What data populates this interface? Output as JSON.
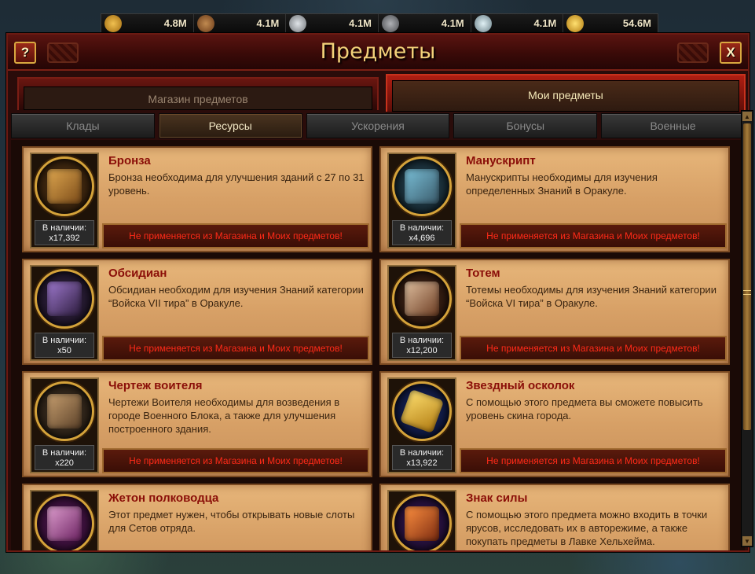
{
  "resources": [
    {
      "icon": "wheat-icon",
      "value": "4.8M",
      "color": "#d9a030"
    },
    {
      "icon": "wood-icon",
      "value": "4.1M",
      "color": "#a06a3a"
    },
    {
      "icon": "iron-icon",
      "value": "4.1M",
      "color": "#c0c4c8"
    },
    {
      "icon": "stone-icon",
      "value": "4.1M",
      "color": "#8a8c90"
    },
    {
      "icon": "silver-icon",
      "value": "4.1M",
      "color": "#b4c8d0"
    },
    {
      "icon": "gold-icon",
      "value": "54.6M",
      "color": "#f0c030"
    }
  ],
  "window": {
    "title": "Предметы",
    "help_label": "?",
    "close_label": "X"
  },
  "tabs": {
    "shop": "Магазин предметов",
    "mine": "Мои предметы",
    "active": "mine"
  },
  "subtabs": [
    {
      "label": "Клады",
      "active": false
    },
    {
      "label": "Ресурсы",
      "active": true
    },
    {
      "label": "Ускорения",
      "active": false
    },
    {
      "label": "Бонусы",
      "active": false
    },
    {
      "label": "Военные",
      "active": false
    }
  ],
  "stock_label": "В наличии:",
  "not_applicable": "Не применяется из Магазина и Моих предметов!",
  "items": [
    {
      "name": "Бронза",
      "desc": "Бронза необходима для улучшения зданий с 27 по 31 уровень.",
      "stock": "x17,392",
      "icon": "bronze-icon",
      "color": "#b87a30"
    },
    {
      "name": "Манускрипт",
      "desc": "Манускрипты необходимы для изучения определенных Знаний в Оракуле.",
      "stock": "x4,696",
      "icon": "manuscript-icon",
      "color": "#4a8aa0"
    },
    {
      "name": "Обсидиан",
      "desc": "Обсидиан необходим для изучения Знаний категории “Войска VII тира” в Оракуле.",
      "stock": "x50",
      "icon": "obsidian-icon",
      "color": "#5a3a7a"
    },
    {
      "name": "Тотем",
      "desc": "Тотемы необходимы для изучения Знаний категории “Войска VI тира” в Оракуле.",
      "stock": "x12,200",
      "icon": "totem-icon",
      "color": "#a0603a"
    },
    {
      "name": "Чертеж воителя",
      "desc": "Чертежи Воителя необходимы для возведения в городе Военного Блока, а также для улучшения построенного здания.",
      "stock": "x220",
      "icon": "blueprint-icon",
      "color": "#8a6a4a"
    },
    {
      "name": "Звездный осколок",
      "desc": "С помощью этого предмета вы сможете повысить уровень скина города.",
      "stock": "x13,922",
      "icon": "star-shard-icon",
      "color": "#e0b030"
    },
    {
      "name": "Жетон полководца",
      "desc": "Этот предмет нужен, чтобы открывать новые слоты для Сетов отряда.",
      "stock": "",
      "icon": "commander-token-icon",
      "color": "#9a3aa0"
    },
    {
      "name": "Знак силы",
      "desc": "С помощью этого предмета можно входить в точки ярусов, исследовать их в авторежиме, а также покупать предметы в Лавке Хельхейма.",
      "stock": "",
      "icon": "power-sign-icon",
      "color": "#e06020"
    }
  ],
  "scroll": {
    "up": "▲",
    "down": "▼"
  }
}
